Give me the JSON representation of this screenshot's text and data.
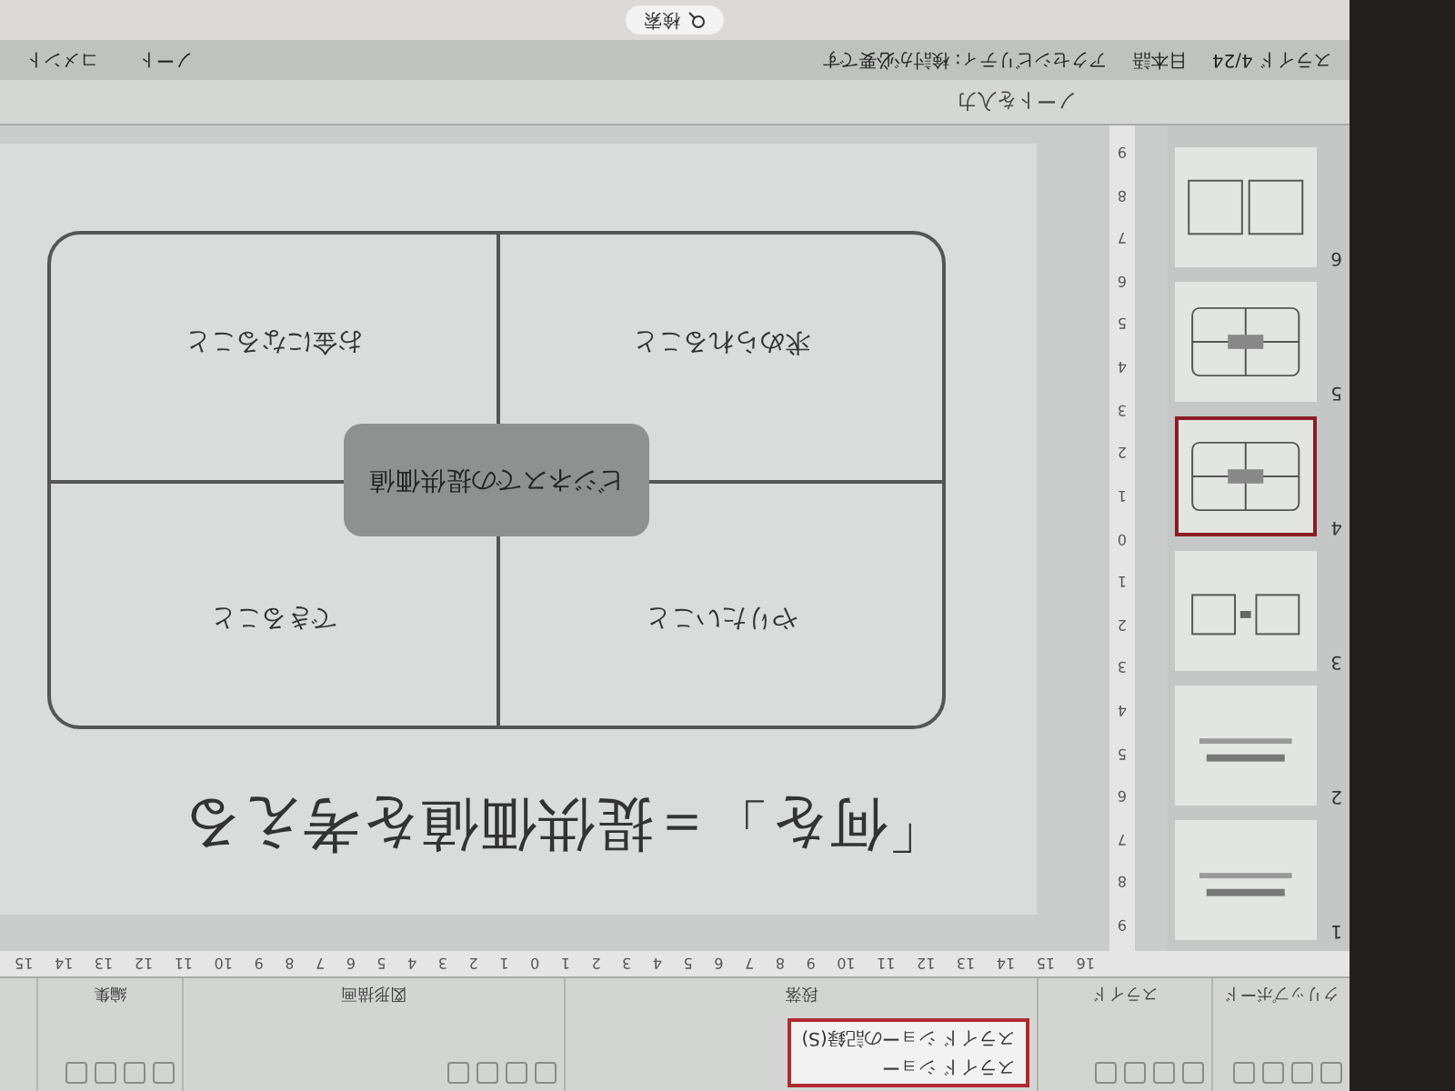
{
  "ribbon": {
    "groups": [
      {
        "label": "クリップボード"
      },
      {
        "label": "スライド"
      },
      {
        "label": "段落"
      },
      {
        "label": "図形描画"
      },
      {
        "label": "編集"
      }
    ],
    "popup": {
      "title": "スライド ショー",
      "item": "スライド ショーの記録(S)"
    }
  },
  "horizontal_ruler": [
    "16",
    "15",
    "14",
    "13",
    "12",
    "11",
    "10",
    "9",
    "8",
    "7",
    "6",
    "5",
    "4",
    "3",
    "2",
    "1",
    "0",
    "1",
    "2",
    "3",
    "4",
    "5",
    "6",
    "7",
    "8",
    "9",
    "10",
    "11",
    "12",
    "13",
    "14",
    "15"
  ],
  "vertical_ruler": [
    "9",
    "8",
    "7",
    "6",
    "5",
    "4",
    "3",
    "2",
    "1",
    "0",
    "1",
    "2",
    "3",
    "4",
    "5",
    "6",
    "7",
    "8",
    "9"
  ],
  "thumbnails": [
    {
      "number": "1",
      "kind": "text",
      "selected": false
    },
    {
      "number": "2",
      "kind": "text",
      "selected": false
    },
    {
      "number": "3",
      "kind": "boxes",
      "selected": false
    },
    {
      "number": "4",
      "kind": "grid",
      "selected": true
    },
    {
      "number": "5",
      "kind": "grid",
      "selected": false
    },
    {
      "number": "6",
      "kind": "tables",
      "selected": false
    }
  ],
  "slide": {
    "title": "「何を」＝提供価値を考える",
    "center": "ビジネスでの提供価値",
    "cells": [
      "やりたいこと",
      "できること",
      "求められること",
      "お金になること"
    ]
  },
  "notes": {
    "placeholder": "ノートを入力"
  },
  "status_bar": {
    "slide": "スライド 4/24",
    "language": "日本語",
    "accessibility": "アクセシビリティ: 検討が必要です",
    "notes": "ノート",
    "comments": "コメント"
  },
  "taskbar": {
    "search": "検索"
  }
}
